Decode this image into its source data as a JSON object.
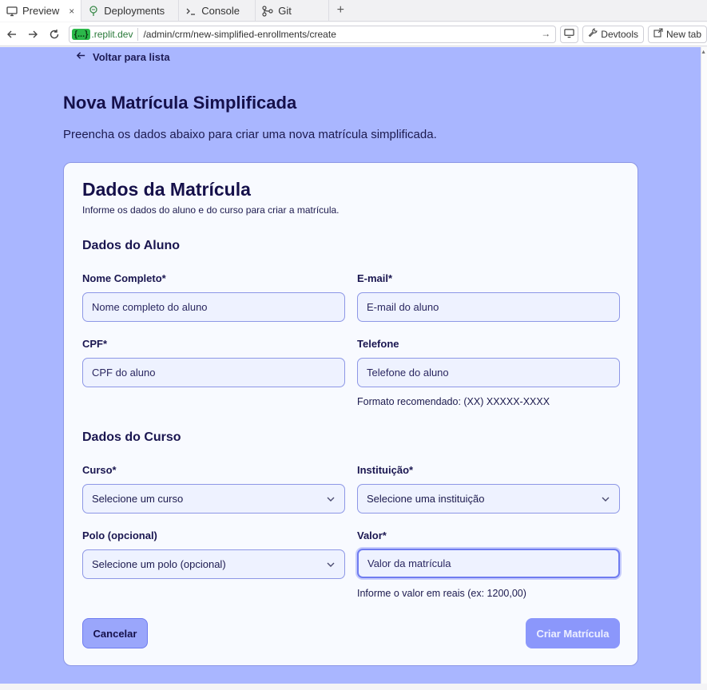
{
  "browser": {
    "tabs": [
      {
        "label": "Preview",
        "icon": "monitor-icon",
        "active": true,
        "close": "×"
      },
      {
        "label": "Deployments",
        "icon": "deploy-icon",
        "active": false
      },
      {
        "label": "Console",
        "icon": "terminal-icon",
        "active": false
      },
      {
        "label": "Git",
        "icon": "git-icon",
        "active": false
      }
    ],
    "new_tab_label": "+",
    "url_badge": "{...}",
    "url_domain": ".replit.dev",
    "url_path": "/admin/crm/new-simplified-enrollments/create",
    "devtools_label": "Devtools",
    "new_tab_button_label": "New tab"
  },
  "page": {
    "back_label": "Voltar para lista",
    "title": "Nova Matrícula Simplificada",
    "subtitle": "Preencha os dados abaixo para criar uma nova matrícula simplificada."
  },
  "card": {
    "title": "Dados da Matrícula",
    "description": "Informe os dados do aluno e do curso para criar a matrícula.",
    "student_section": "Dados do Aluno",
    "course_section": "Dados do Curso"
  },
  "fields": {
    "name": {
      "label": "Nome Completo*",
      "placeholder": "Nome completo do aluno",
      "value": ""
    },
    "email": {
      "label": "E-mail*",
      "placeholder": "E-mail do aluno",
      "value": ""
    },
    "cpf": {
      "label": "CPF*",
      "placeholder": "CPF do aluno",
      "value": ""
    },
    "phone": {
      "label": "Telefone",
      "placeholder": "Telefone do aluno",
      "value": "",
      "hint": "Formato recomendado: (XX) XXXXX-XXXX"
    },
    "course": {
      "label": "Curso*",
      "selected": "Selecione um curso"
    },
    "institution": {
      "label": "Instituição*",
      "selected": "Selecione uma instituição"
    },
    "campus": {
      "label": "Polo (opcional)",
      "selected": "Selecione um polo (opcional)"
    },
    "value": {
      "label": "Valor*",
      "placeholder": "Valor da matrícula",
      "value": "",
      "hint": "Informe o valor em reais (ex: 1200,00)"
    }
  },
  "actions": {
    "cancel": "Cancelar",
    "submit": "Criar Matrícula"
  },
  "colors": {
    "page_background": "#a9b6ff",
    "card_background": "#f8faff",
    "accent": "#8b97fb",
    "text_dark": "#15104a"
  }
}
